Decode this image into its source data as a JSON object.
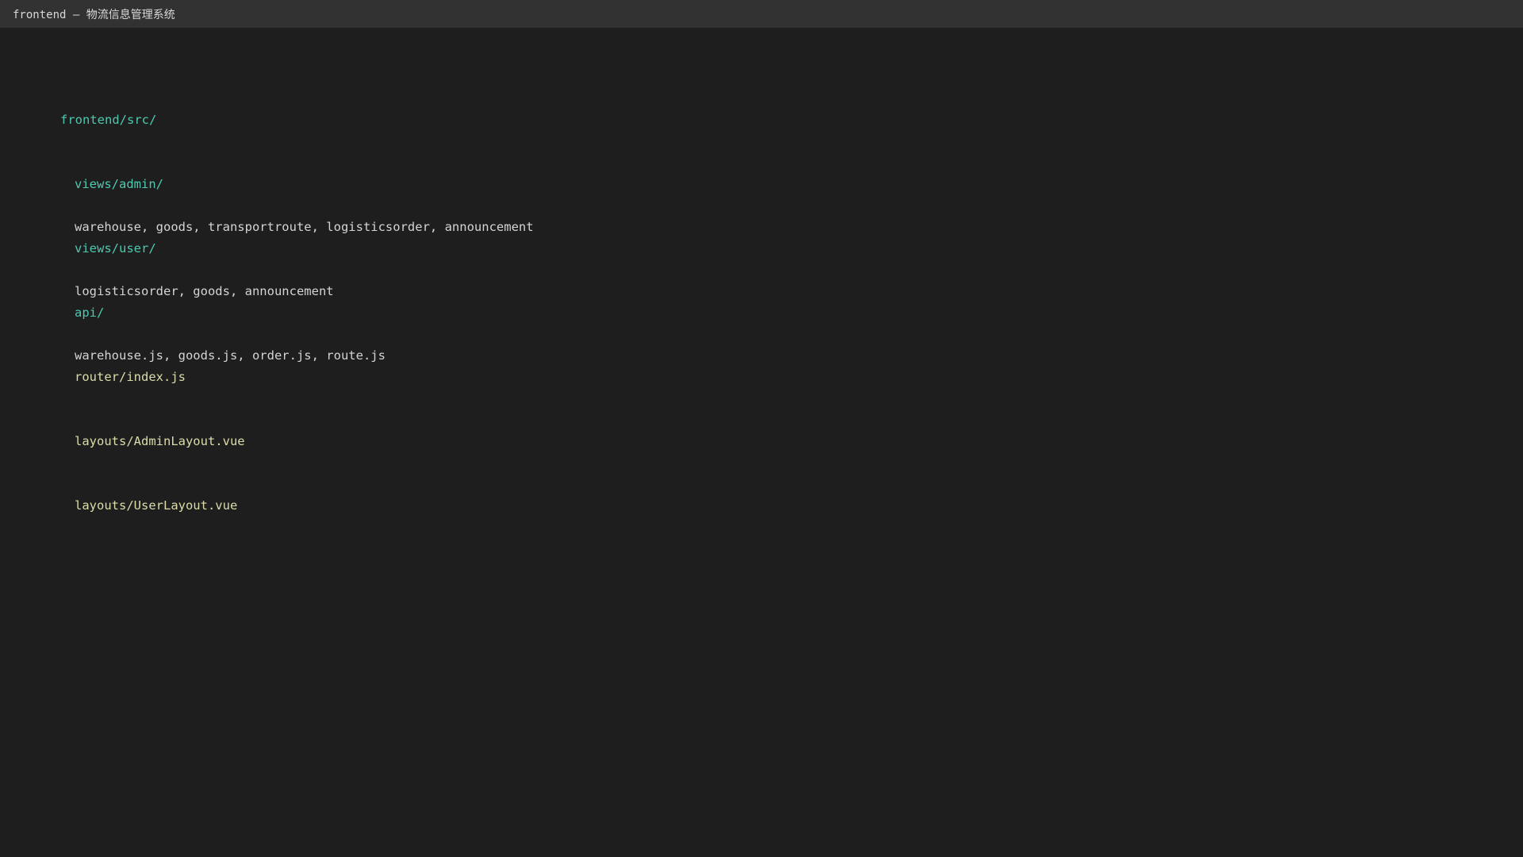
{
  "window": {
    "title": "frontend — 物流信息管理系统"
  },
  "tree": {
    "root": "frontend/src/",
    "admin_dir": "views/admin/",
    "admin_items": "warehouse, goods, transportroute, logisticsorder, announcement",
    "user_dir": "views/user/",
    "user_items": "logisticsorder, goods, announcement",
    "api_dir": "api/",
    "api_items": "warehouse.js, goods.js, order.js, route.js",
    "router_file": "router/index.js",
    "admin_layout_file": "layouts/AdminLayout.vue",
    "user_layout_file": "layouts/UserLayout.vue"
  },
  "colors": {
    "background": "#1e1e1e",
    "title_bar": "#323232",
    "directory": "#4ec9b0",
    "plain_text": "#d4d4d4",
    "file": "#dcdcaa"
  }
}
